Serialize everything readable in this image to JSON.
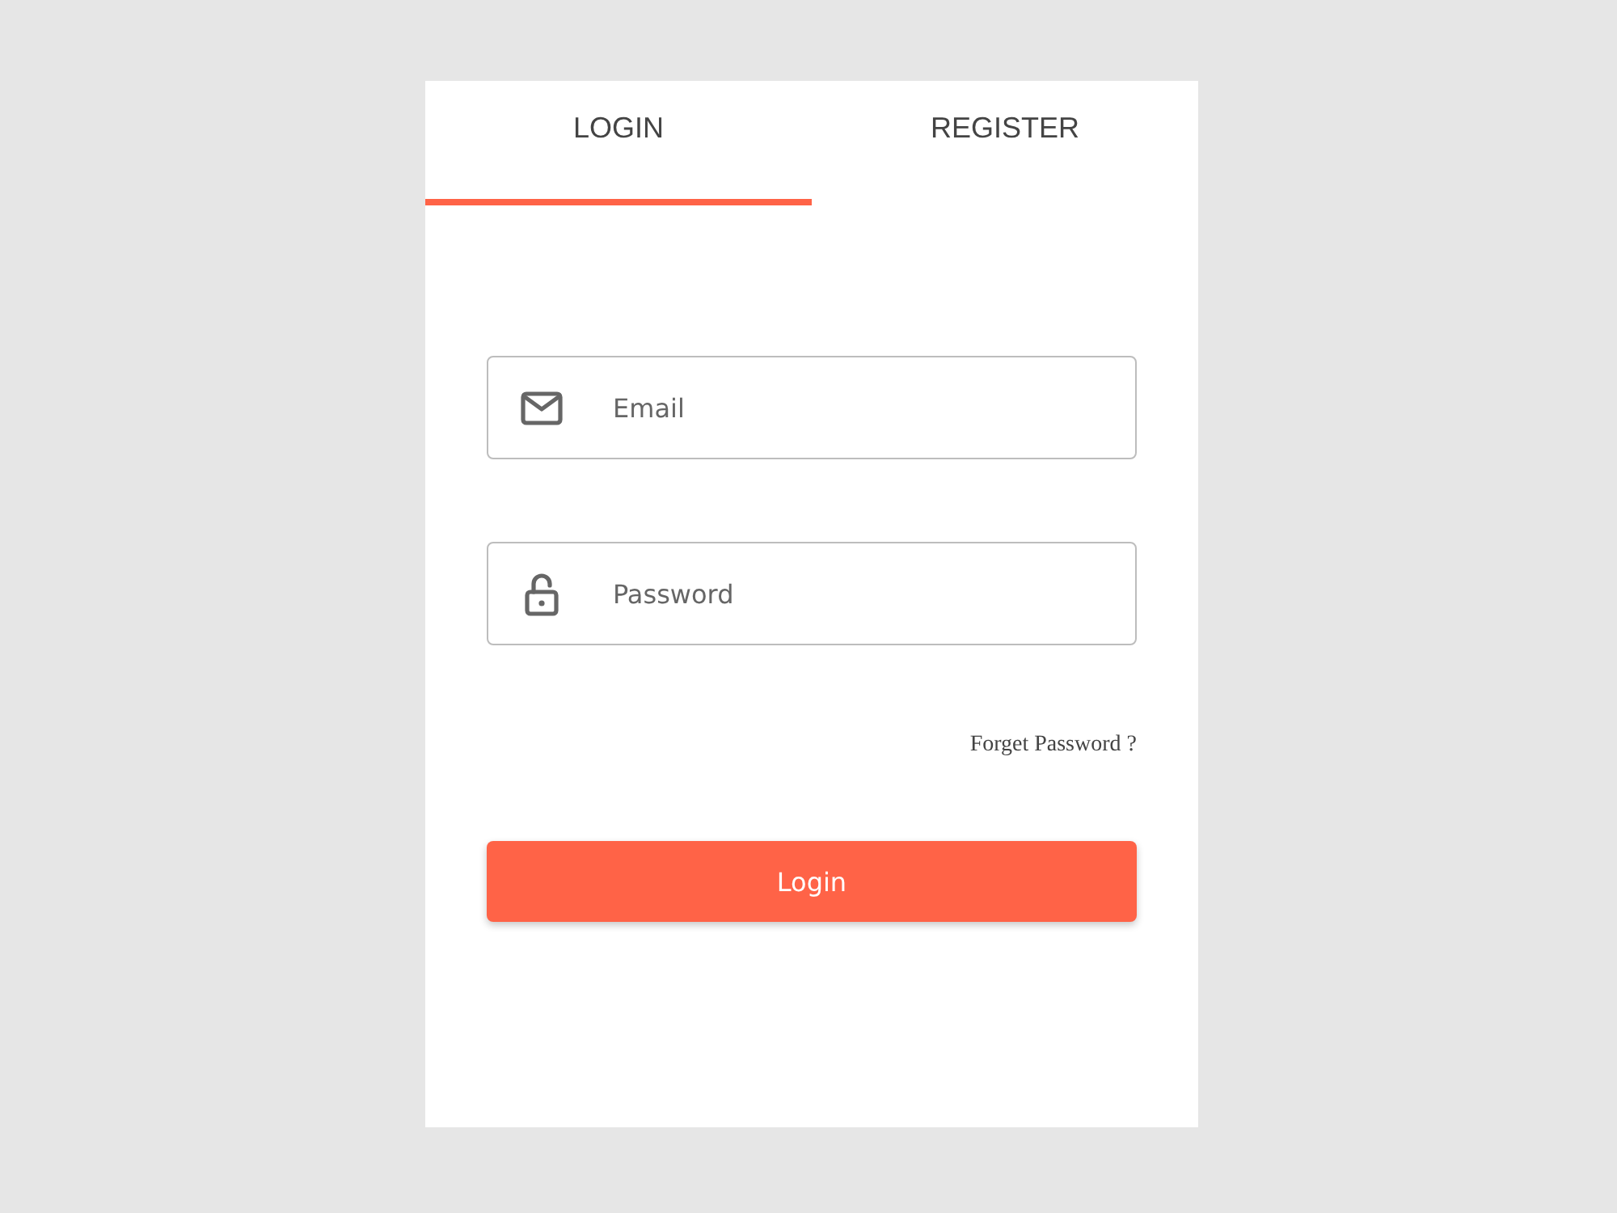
{
  "tabs": [
    {
      "label": "LOGIN",
      "selected": true
    },
    {
      "label": "REGISTER",
      "selected": false
    }
  ],
  "fields": [
    {
      "kind": "email",
      "placeholder": "Email"
    },
    {
      "kind": "password",
      "placeholder": "Password"
    }
  ],
  "forgot_link": "Forget Password ?",
  "submit_button": "Login"
}
